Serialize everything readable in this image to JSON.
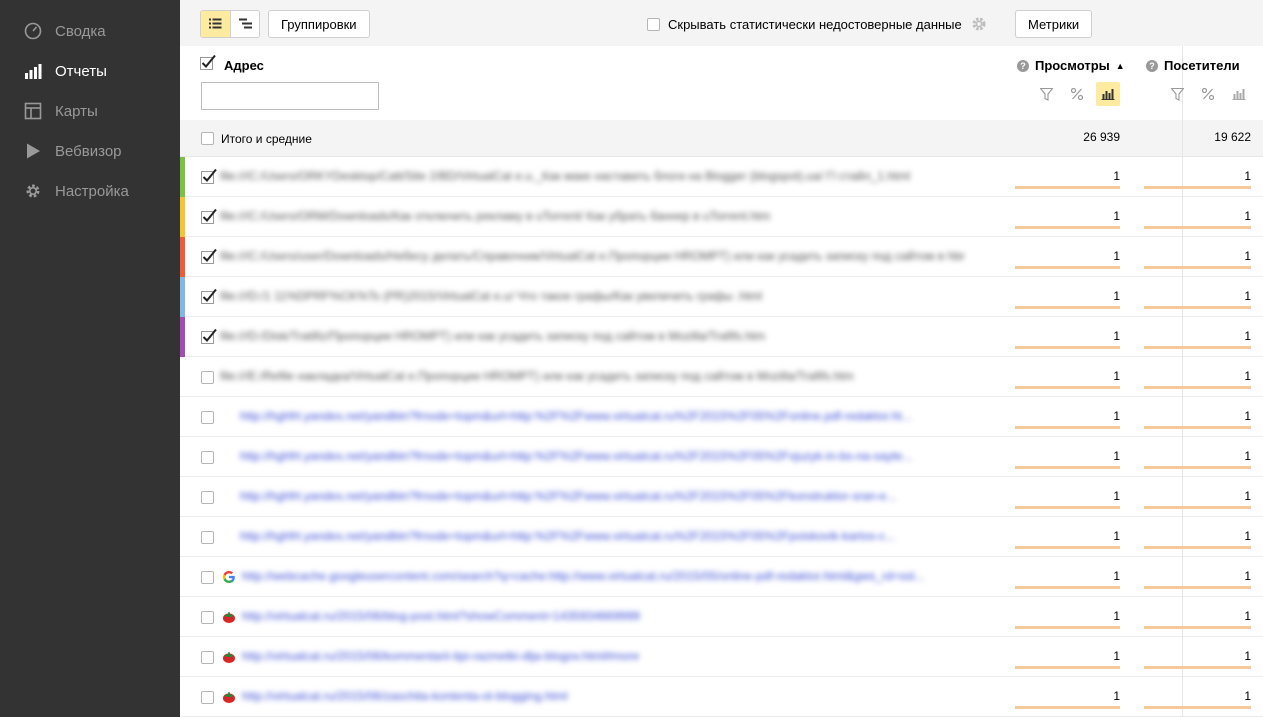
{
  "sidebar": {
    "items": [
      {
        "label": "Сводка",
        "icon": "gauge-icon",
        "active": false
      },
      {
        "label": "Отчеты",
        "icon": "bar-chart-icon",
        "active": true
      },
      {
        "label": "Карты",
        "icon": "map-layout-icon",
        "active": false
      },
      {
        "label": "Вебвизор",
        "icon": "play-icon",
        "active": false
      },
      {
        "label": "Настройка",
        "icon": "gear-icon",
        "active": false
      }
    ]
  },
  "toolbar": {
    "groupings_label": "Группировки",
    "hide_unreliable_label": "Скрывать статистически недостоверные данные",
    "metrics_label": "Метрики"
  },
  "header": {
    "address_label": "Адрес",
    "address_filter_placeholder": "",
    "col_views": "Просмотры",
    "col_views_sort": "▲",
    "col_visitors": "Посетители"
  },
  "totals": {
    "label": "Итого и средние",
    "views": "26 939",
    "visitors": "19 622"
  },
  "colors": {
    "sidebar_bg": "#333333",
    "accent_yellow": "#ffeba0",
    "bar_color": "#f6c99a",
    "link_color": "#3b4fd6",
    "strip_colors": [
      "#7ac142",
      "#f5c431",
      "#ef5a37",
      "#7fb9e3",
      "#a34db2"
    ]
  },
  "rows": [
    {
      "checked": true,
      "strip": "#7ac142",
      "favicon": "",
      "type": "plain",
      "indent": false,
      "text": "file:///C:/Users/ORKYDesktop/Catt/Site 2/BD/VirtualCat e.u._Как макe наставить блоги на Blogger (blogspot).ua/ Гl стайл_1.html",
      "views": "1",
      "visitors": "1"
    },
    {
      "checked": true,
      "strip": "#f5c431",
      "favicon": "",
      "type": "plain",
      "indent": false,
      "text": "file:///C:/Users/ORM/Downloads/Как отключить рекламу в uTorrent/ Как убрать баннер в uTorrent.htm",
      "views": "1",
      "visitors": "1"
    },
    {
      "checked": true,
      "strip": "#ef5a37",
      "favicon": "",
      "type": "plain",
      "indent": false,
      "text": "file:///C:/Users/user/Downloads/Небесу делать/Справочник/VirtualCat e.Пропорции HROMPT) или как усадить записку под сайтом в hbr",
      "views": "1",
      "visitors": "1"
    },
    {
      "checked": true,
      "strip": "#7fb9e3",
      "favicon": "",
      "type": "plain",
      "indent": false,
      "text": "file:///D:/1 11%DPRF%CK%Ts (PR)2015/VirtualCat e.u/ Что такое графы/Как увеличить графы .html",
      "views": "1",
      "visitors": "1"
    },
    {
      "checked": true,
      "strip": "#a34db2",
      "favicon": "",
      "type": "plain",
      "indent": false,
      "text": "file:///D:/Disk/Tratifiz/Пропорции HROMPT) или как усадить записку под сайтом в Mozilla/Trafifs.htm",
      "views": "1",
      "visitors": "1"
    },
    {
      "checked": false,
      "strip": "",
      "favicon": "",
      "type": "plain",
      "indent": false,
      "text": "file:///E:/Refile накладка/VirtualCat e.Пропорции HROMPT) или как усадить записку под сайтом в Mozilla/Trafifs.htm",
      "views": "1",
      "visitors": "1"
    },
    {
      "checked": false,
      "strip": "",
      "favicon": "",
      "type": "link",
      "indent": true,
      "text": "http://hghfrt.yandex.net/yandbtn?frnode=topm&url=http:%2F%2Fwww.virtualcat.ru%2F2015%2F05%2Fonline.pdf-redaktor.ht...",
      "views": "1",
      "visitors": "1"
    },
    {
      "checked": false,
      "strip": "",
      "favicon": "",
      "type": "link",
      "indent": true,
      "text": "http://hghfrt.yandex.net/yandbtn?frnode=topm&url=http:%2F%2Fwww.virtualcat.ru%2F2015%2F05%2Fvjuzyk-in-bs-na-sayte...",
      "views": "1",
      "visitors": "1"
    },
    {
      "checked": false,
      "strip": "",
      "favicon": "",
      "type": "link",
      "indent": true,
      "text": "http://hghfrt.yandex.net/yandbtn?frnode=topm&url=http:%2F%2Fwww.virtualcat.ru%2F2015%2F05%2Fkonstruktor-sran-e...",
      "views": "1",
      "visitors": "1"
    },
    {
      "checked": false,
      "strip": "",
      "favicon": "",
      "type": "link",
      "indent": true,
      "text": "http://hghfrt.yandex.net/yandbtn?frnode=topm&url=http:%2F%2Fwww.virtualcat.ru%2F2015%2F05%2Fpoiskovik-kartos-c...",
      "views": "1",
      "visitors": "1"
    },
    {
      "checked": false,
      "strip": "",
      "favicon": "google-icon",
      "type": "link",
      "indent": false,
      "text": "http://webcache.googleusercontent.com/search?q=cache:http://www.virtualcat.ru/2015/05/online-pdf-redaktor.html&gws_rd=ssl...",
      "views": "1",
      "visitors": "1"
    },
    {
      "checked": false,
      "strip": "",
      "favicon": "tomato-icon",
      "type": "link",
      "indent": false,
      "text": "http://virtualcat.ru/2015/06/blog-post.html?showComment=1435934669999",
      "views": "1",
      "visitors": "1"
    },
    {
      "checked": false,
      "strip": "",
      "favicon": "tomato-icon",
      "type": "link",
      "indent": false,
      "text": "http://virtualcat.ru/2015/06/kommentarii-tipi-razmetki-dlja-blogov.html#more",
      "views": "1",
      "visitors": "1"
    },
    {
      "checked": false,
      "strip": "",
      "favicon": "tomato-icon",
      "type": "link",
      "indent": false,
      "text": "http://virtualcat.ru/2015/06/zaschita-kontenta-ot-blogging.html",
      "views": "1",
      "visitors": "1"
    }
  ]
}
